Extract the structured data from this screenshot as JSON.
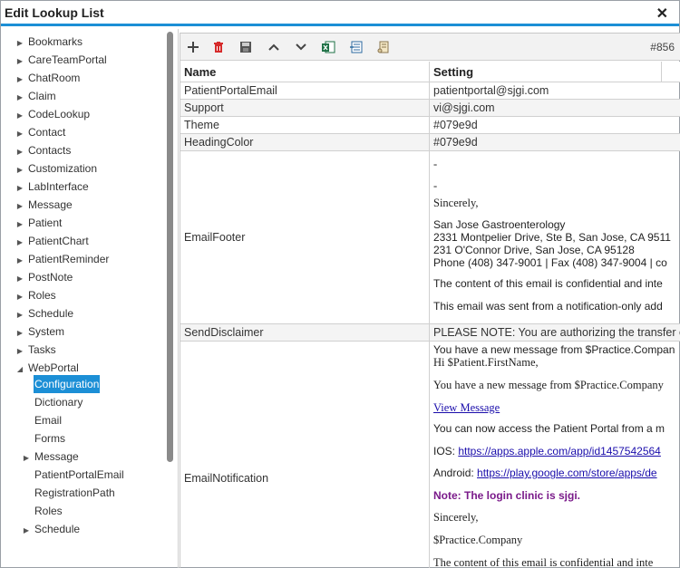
{
  "window": {
    "title": "Edit Lookup List",
    "close_icon": "close-icon"
  },
  "sidebar": {
    "items": [
      {
        "label": "Bookmarks"
      },
      {
        "label": "CareTeamPortal"
      },
      {
        "label": "ChatRoom"
      },
      {
        "label": "Claim"
      },
      {
        "label": "CodeLookup"
      },
      {
        "label": "Contact"
      },
      {
        "label": "Contacts"
      },
      {
        "label": "Customization"
      },
      {
        "label": "LabInterface"
      },
      {
        "label": "Message"
      },
      {
        "label": "Patient"
      },
      {
        "label": "PatientChart"
      },
      {
        "label": "PatientReminder"
      },
      {
        "label": "PostNote"
      },
      {
        "label": "Roles"
      },
      {
        "label": "Schedule"
      },
      {
        "label": "System"
      },
      {
        "label": "Tasks"
      },
      {
        "label": "WebPortal"
      }
    ],
    "webportal_children": [
      {
        "label": "Configuration",
        "selected": true
      },
      {
        "label": "Dictionary"
      },
      {
        "label": "Email"
      },
      {
        "label": "Forms"
      },
      {
        "label": "Message",
        "expandable": true
      },
      {
        "label": "PatientPortalEmail"
      },
      {
        "label": "RegistrationPath"
      },
      {
        "label": "Roles"
      },
      {
        "label": "Schedule",
        "expandable": true
      }
    ]
  },
  "toolbar": {
    "record_label": "#856",
    "buttons": [
      "add-icon",
      "delete-icon",
      "save-icon",
      "move-up-icon",
      "move-down-icon",
      "excel-export-icon",
      "import-icon",
      "scroll-icon"
    ]
  },
  "grid": {
    "columns": [
      "Name",
      "Setting"
    ],
    "rows": {
      "r1": {
        "name": "PatientPortalEmail",
        "setting": "patientportal@sjgi.com"
      },
      "r2": {
        "name": "Support",
        "setting": "vi@sjgi.com"
      },
      "r3": {
        "name": "Theme",
        "setting": "#079e9d"
      },
      "r4": {
        "name": "HeadingColor",
        "setting": "#079e9d"
      },
      "r5": {
        "name": "EmailFooter",
        "dash1": "-",
        "dash2": "-",
        "sincerely": "Sincerely,",
        "l1": "San Jose Gastroenterology",
        "l2": "2331 Montpelier Drive, Ste B, San Jose, CA 9511",
        "l3": "231 O'Connor Drive, San Jose, CA 95128",
        "l4": "Phone (408) 347-9001 | Fax (408) 347-9004 | co",
        "l5": "The content of this email is confidential and inte",
        "l6": "This email was sent from a notification-only add"
      },
      "r6": {
        "name": "SendDisclaimer",
        "setting": "PLEASE NOTE: You are authorizing the transfer c"
      },
      "r7": {
        "name": "EmailNotification",
        "l1": "You have a new message from $Practice.Compan",
        "l2": "Hi $Patient.FirstName,",
        "l3": "You have a new message from $Practice.Company",
        "l4": "View Message",
        "l5": "You can now access the Patient Portal from a m",
        "l6_prefix": "IOS: ",
        "l6_link": "https://apps.apple.com/app/id1457542564",
        "l7_prefix": "Android: ",
        "l7_link": "https://play.google.com/store/apps/de",
        "l8": "Note: The login clinic is sjgi.",
        "l9": "Sincerely,",
        "l10": "$Practice.Company",
        "l11": "The content of this email is confidential and inte"
      }
    }
  }
}
